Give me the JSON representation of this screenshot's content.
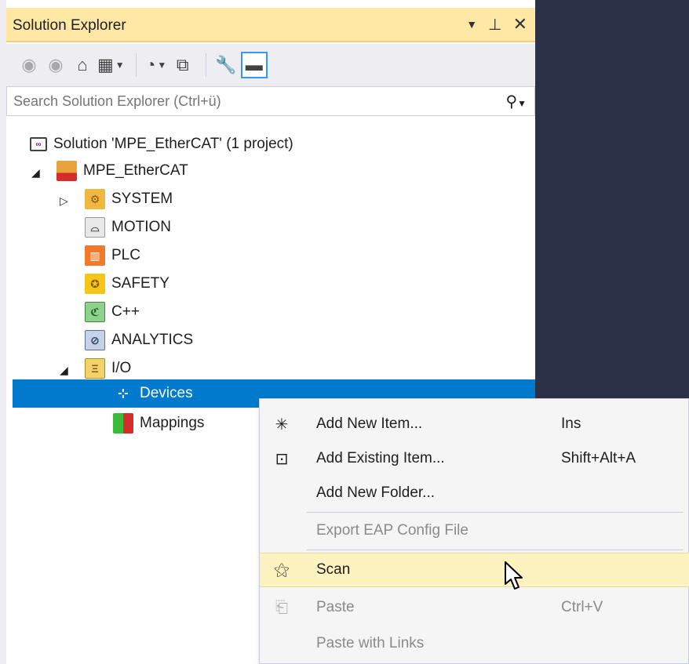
{
  "panel": {
    "title": "Solution Explorer",
    "title_icons": [
      "dropdown-arrow-icon",
      "pin-icon",
      "close-icon"
    ]
  },
  "toolbar": {
    "buttons": [
      "back-icon",
      "forward-icon",
      "home-icon",
      "switch-views-icon",
      "pending-changes-filter-icon",
      "collapse-all-icon",
      "properties-icon",
      "preview-selected-icon"
    ]
  },
  "search": {
    "placeholder": "Search Solution Explorer (Ctrl+ü)"
  },
  "tree": {
    "solution": "Solution 'MPE_EtherCAT' (1 project)",
    "project": "MPE_EtherCAT",
    "system": "SYSTEM",
    "motion": "MOTION",
    "plc": "PLC",
    "safety": "SAFETY",
    "cpp": "C++",
    "analytics": "ANALYTICS",
    "io": "I/O",
    "devices": "Devices",
    "mappings": "Mappings"
  },
  "menu": {
    "add_new_item": "Add New Item...",
    "add_new_item_key": "Ins",
    "add_existing_item": "Add Existing Item...",
    "add_existing_item_key": "Shift+Alt+A",
    "add_new_folder": "Add New Folder...",
    "export_eap": "Export EAP Config File",
    "scan": "Scan",
    "paste": "Paste",
    "paste_key": "Ctrl+V",
    "paste_links": "Paste with Links"
  },
  "colors": {
    "title_bar": "#ffe8a6",
    "selection": "#007acc",
    "menu_hover": "#fdf3c0",
    "ide_background": "#2b3247"
  }
}
